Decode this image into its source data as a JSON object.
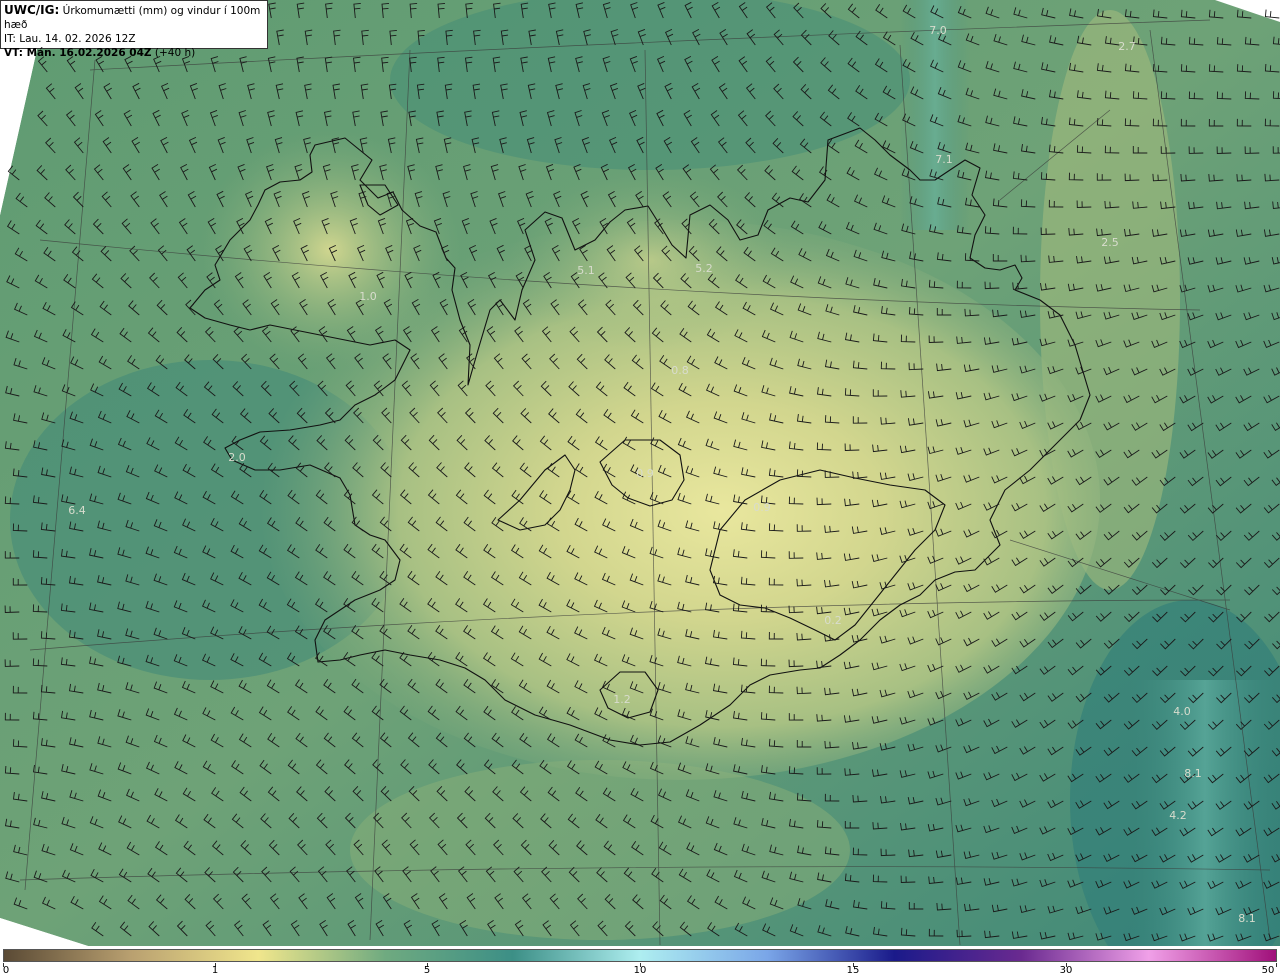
{
  "header": {
    "line1_bold": "UWC/IG:",
    "line1_rest": " Úrkomumætti (mm) og vindur í 100m hæð",
    "line2": "IT: Lau. 14. 02. 2026 12Z",
    "line3_bold": "VT: Mán. 16.02.2026 04Z",
    "line3_rest": " (+40 h)"
  },
  "map_values": [
    {
      "text": "7.0"
    },
    {
      "text": "2.7"
    },
    {
      "text": "7.1"
    },
    {
      "text": "2.5"
    },
    {
      "text": "5.1"
    },
    {
      "text": "5.2"
    },
    {
      "text": "1.0"
    },
    {
      "text": "0.8"
    },
    {
      "text": "2.0"
    },
    {
      "text": "0.9"
    },
    {
      "text": "0.9"
    },
    {
      "text": "6.4"
    },
    {
      "text": "0.2"
    },
    {
      "text": "1.2"
    },
    {
      "text": "4.0"
    },
    {
      "text": "8.1"
    },
    {
      "text": "4.2"
    },
    {
      "text": "8.1"
    }
  ],
  "colorbar": {
    "labels": [
      "0",
      "1",
      "5",
      "10",
      "15",
      "30",
      "50"
    ]
  },
  "colors": {
    "sea_low": "#3f8a78",
    "sea_mid": "#5a9a74",
    "land_high": "#e7e59a",
    "coast": "#111111",
    "colorbar_stops": [
      "#5a4a35",
      "#b9a070",
      "#f0e68c",
      "#6faa80",
      "#3c8f86",
      "#aeeef0",
      "#7aa6e8",
      "#1a1a8a",
      "#6a2a90",
      "#f0a0e8",
      "#a0107a"
    ]
  }
}
